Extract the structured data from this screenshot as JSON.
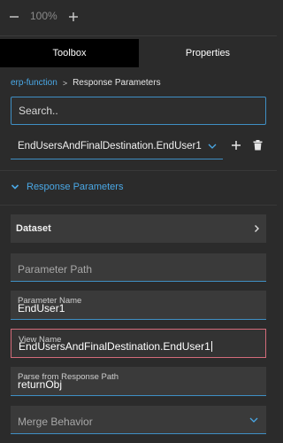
{
  "zoom": {
    "value": "100%"
  },
  "tabs": {
    "toolbox": "Toolbox",
    "properties": "Properties"
  },
  "breadcrumb": {
    "parent": "erp-function",
    "current": "Response Parameters"
  },
  "search": {
    "placeholder": "Search.."
  },
  "selector": {
    "selected": "EndUsersAndFinalDestination.EndUser1"
  },
  "section": {
    "title": "Response Parameters"
  },
  "dataset": {
    "label": "Dataset"
  },
  "fields": {
    "parameter_path": {
      "placeholder": "Parameter Path"
    },
    "parameter_name": {
      "label": "Parameter Name",
      "value": "EndUser1"
    },
    "view_name": {
      "label": "View Name",
      "value": "EndUsersAndFinalDestination.EndUser1"
    },
    "parse_path": {
      "label": "Parse from Response Path",
      "value": "returnObj"
    },
    "merge_behavior": {
      "placeholder": "Merge Behavior"
    }
  },
  "colors": {
    "accent": "#4aa8e6",
    "active_tab": "#000000",
    "error_border": "#d36b7a"
  }
}
